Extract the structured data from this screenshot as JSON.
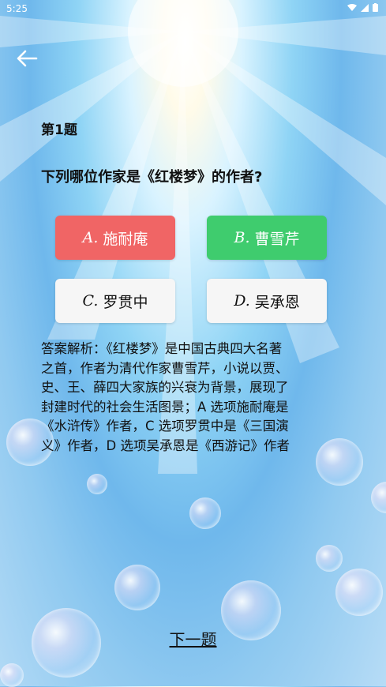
{
  "status_bar": {
    "time": "5:25"
  },
  "header": {
    "back_icon": "arrow-left-icon"
  },
  "question": {
    "number": "第1题",
    "text": "下列哪位作家是《红楼梦》的作者?"
  },
  "options": [
    {
      "letter": "A.",
      "text": "施耐庵",
      "state": "wrong",
      "color": "#f06565"
    },
    {
      "letter": "B.",
      "text": "曹雪芹",
      "state": "correct",
      "color": "#3fcc6e"
    },
    {
      "letter": "C.",
      "text": "罗贯中",
      "state": "neutral",
      "color": "#f6f6f6"
    },
    {
      "letter": "D.",
      "text": "吴承恩",
      "state": "neutral",
      "color": "#f6f6f6"
    }
  ],
  "analysis": {
    "lines": [
      "答案解析：《红楼梦》是中国古典四大名著",
      "之首，作者为清代作家曹雪芹，小说以贾、",
      "史、王、薛四大家族的兴衰为背景，展现了",
      "封建时代的社会生活图景；A 选项施耐庵是",
      "《水浒传》作者，C 选项罗贯中是《三国演",
      "义》作者，D 选项吴承恩是《西游记》作者"
    ]
  },
  "footer": {
    "next_label": "下一题"
  }
}
